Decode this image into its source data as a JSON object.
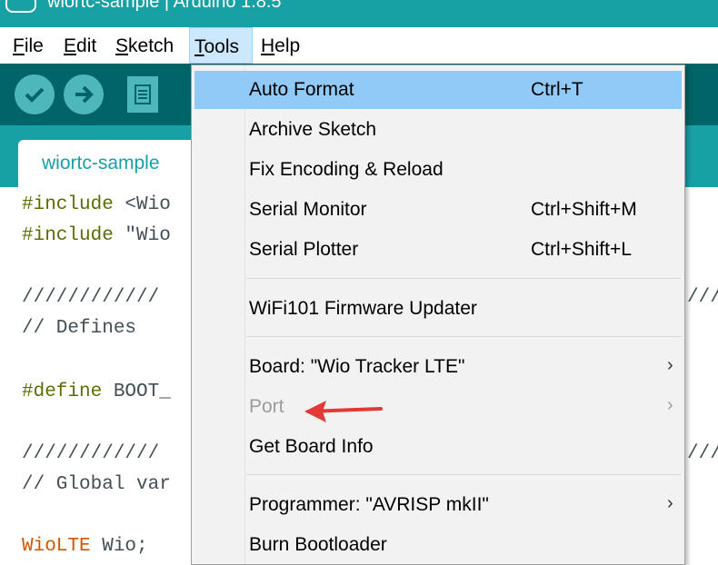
{
  "window": {
    "title": "wiortc-sample | Arduino 1.8.5"
  },
  "menubar": {
    "items": [
      {
        "label": "File",
        "accel": "F",
        "rest": "ile"
      },
      {
        "label": "Edit",
        "accel": "E",
        "rest": "dit"
      },
      {
        "label": "Sketch",
        "accel": "S",
        "rest": "ketch"
      },
      {
        "label": "Tools",
        "accel": "T",
        "rest": "ools"
      },
      {
        "label": "Help",
        "accel": "H",
        "rest": "elp"
      }
    ]
  },
  "toolbar": {
    "buttons": [
      "verify-icon",
      "upload-icon",
      "new-icon"
    ]
  },
  "tabs": [
    {
      "label": "wiortc-sample"
    }
  ],
  "editor": {
    "lines": [
      {
        "kw": "#include",
        "rest": " <Wio"
      },
      {
        "kw": "#include",
        "rest": " \"Wio"
      },
      {
        "kw": "",
        "rest": "////////////"
      },
      {
        "kw": "",
        "rest": "// Defines"
      },
      {
        "kw": "#define",
        "rest": " BOOT_"
      },
      {
        "kw": "",
        "rest": "////////////"
      },
      {
        "kw": "",
        "rest": "// Global var"
      },
      {
        "kw": "WioLTE",
        "rest": " Wio;"
      }
    ],
    "right_overflow": "///"
  },
  "tools_menu": {
    "items": [
      {
        "label": "Auto Format",
        "shortcut": "Ctrl+T",
        "highlighted": true
      },
      {
        "label": "Archive Sketch"
      },
      {
        "label": "Fix Encoding & Reload"
      },
      {
        "label": "Serial Monitor",
        "shortcut": "Ctrl+Shift+M"
      },
      {
        "label": "Serial Plotter",
        "shortcut": "Ctrl+Shift+L"
      },
      {
        "label": "WiFi101 Firmware Updater"
      },
      {
        "label": "Board: \"Wio Tracker LTE\"",
        "submenu": true
      },
      {
        "label": "Port",
        "submenu": true,
        "disabled": true
      },
      {
        "label": "Get Board Info"
      },
      {
        "label": "Programmer: \"AVRISP mkII\"",
        "submenu": true
      },
      {
        "label": "Burn Bootloader"
      }
    ],
    "submenu_arrow": "›"
  },
  "annotation": {
    "color": "#e53935"
  },
  "colors": {
    "teal": "#17a1a5",
    "dark_teal": "#006468",
    "highlight": "#91c9f7"
  }
}
